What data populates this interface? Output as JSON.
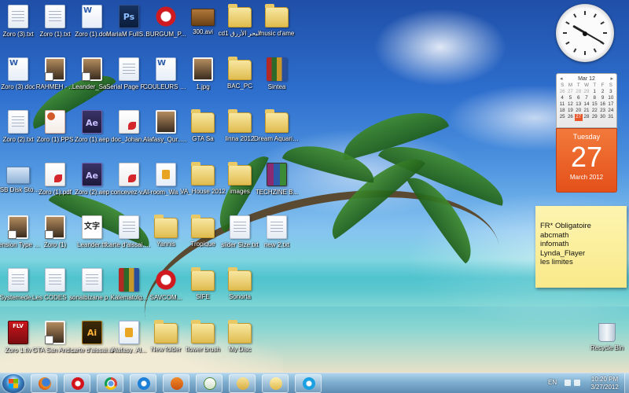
{
  "desktop": {
    "icons": [
      {
        "label": "Zoro (3).txt",
        "type": "doc"
      },
      {
        "label": "Zoro (1).txt",
        "type": "doc"
      },
      {
        "label": "Zoro (1).doc",
        "type": "word"
      },
      {
        "label": "MariaM FullServices...",
        "type": "psd"
      },
      {
        "label": "BURGUM_P...",
        "type": "opera"
      },
      {
        "label": "300.avi",
        "type": "media"
      },
      {
        "label": "cd1 البحر الأزرق",
        "type": "folder"
      },
      {
        "label": "music d'ame",
        "type": "folder"
      },
      {
        "label": "Zoro (3).doc",
        "type": "word"
      },
      {
        "label": "RAHMEH - ...",
        "type": "image"
      },
      {
        "label": "Leander_Sa...",
        "type": "image"
      },
      {
        "label": "Serial Page Plus.txt",
        "type": "doc"
      },
      {
        "label": "COULEURS ET COMM...",
        "type": "word"
      },
      {
        "label": "1.jpg",
        "type": "image"
      },
      {
        "label": "BAC_PC",
        "type": "folder"
      },
      {
        "label": "Sintea",
        "type": "books"
      },
      {
        "label": "Zoro (2).txt",
        "type": "doc"
      },
      {
        "label": "Zoro (1).PPS",
        "type": "ppt"
      },
      {
        "label": "Zoro (1).aep",
        "type": "ae"
      },
      {
        "label": "doc_Johan...",
        "type": "pdf"
      },
      {
        "label": "Alafasy_Qur... Liathan.mp3",
        "type": "image"
      },
      {
        "label": "GTA Sa",
        "type": "folder"
      },
      {
        "label": "linna 2012",
        "type": "folder"
      },
      {
        "label": "Dream Aquariu...",
        "type": "folder"
      },
      {
        "label": "USB Disk Storage Fo...",
        "type": "usb"
      },
      {
        "label": "Zoro (1).pdf",
        "type": "pdf"
      },
      {
        "label": "Zoro (2).aep",
        "type": "ae"
      },
      {
        "label": "concevez-v...",
        "type": "pdf"
      },
      {
        "label": "Al-room_Wa min Ayatih...",
        "type": "audio"
      },
      {
        "label": "VA_House 2012",
        "type": "folder"
      },
      {
        "label": "images",
        "type": "folder"
      },
      {
        "label": "TECHZINE B...",
        "type": "rar"
      },
      {
        "label": "Tension Type Font Licens...",
        "type": "image"
      },
      {
        "label": "Zoro (1)",
        "type": "image"
      },
      {
        "label": "Leander.ttf",
        "type": "font"
      },
      {
        "label": "carte d'aissai.jpg",
        "type": "doc"
      },
      {
        "label": "Yannis",
        "type": "folder"
      },
      {
        "label": "Tropique",
        "type": "folder"
      },
      {
        "label": "slider Size.txt",
        "type": "doc"
      },
      {
        "label": "new 2.txt",
        "type": "doc"
      },
      {
        "label": "Systemede...",
        "type": "doc"
      },
      {
        "label": "Les CODES de GTA Sa.txt",
        "type": "doc"
      },
      {
        "label": "sonaibizane password.txt",
        "type": "doc"
      },
      {
        "label": "Kalematolg...",
        "type": "books"
      },
      {
        "label": "SAVCOM...",
        "type": "opera"
      },
      {
        "label": "SIFE",
        "type": "folder"
      },
      {
        "label": "Sonorta",
        "type": "folder"
      },
      {
        "label": "Zoro 1.flv",
        "type": "flv"
      },
      {
        "label": "GTA San Andreas",
        "type": "image"
      },
      {
        "label": "carte d'aissai.ai",
        "type": "ai"
      },
      {
        "label": "Alafasy_Al...",
        "type": "audio"
      },
      {
        "label": "New folder",
        "type": "folder"
      },
      {
        "label": "flower brush",
        "type": "folder"
      },
      {
        "label": "My Disc",
        "type": "folder"
      }
    ],
    "recycle_bin": {
      "label": "Recycle Bin"
    }
  },
  "clock_gadget": {
    "hour_angle_deg": 300,
    "minute_angle_deg": 120
  },
  "calendar_gadget": {
    "month_header": "Mar 12",
    "weekday_initials": [
      "S",
      "M",
      "T",
      "W",
      "T",
      "F",
      "S"
    ],
    "weeks": [
      [
        "26",
        "27",
        "28",
        "29",
        "1",
        "2",
        "3"
      ],
      [
        "4",
        "5",
        "6",
        "7",
        "8",
        "9",
        "10"
      ],
      [
        "11",
        "12",
        "13",
        "14",
        "15",
        "16",
        "17"
      ],
      [
        "18",
        "19",
        "20",
        "21",
        "22",
        "23",
        "24"
      ],
      [
        "25",
        "26",
        "27",
        "28",
        "29",
        "30",
        "31"
      ]
    ],
    "today_index": [
      4,
      2
    ],
    "weekday": "Tuesday",
    "day": "27",
    "month_year": "March 2012",
    "accent_color": "#e8582c"
  },
  "sticky_note": {
    "lines": [
      "FR* Obligatoire",
      "abcmath",
      "infomath",
      "Lynda_Flayer",
      "les limites"
    ]
  },
  "taskbar": {
    "pinned": [
      {
        "name": "firefox",
        "icon": "firefox-icon"
      },
      {
        "name": "opera",
        "icon": "opera-icon"
      },
      {
        "name": "chrome",
        "icon": "chrome-icon"
      },
      {
        "name": "internet-explorer",
        "icon": "ie-icon"
      },
      {
        "name": "media-player",
        "icon": "media-player-icon"
      },
      {
        "name": "notepad",
        "icon": "notepad-icon"
      },
      {
        "name": "windows-explorer",
        "icon": "explorer-icon"
      },
      {
        "name": "folder",
        "icon": "folder-icon"
      },
      {
        "name": "skype",
        "icon": "skype-icon"
      }
    ],
    "language": "EN",
    "time": "10:20 PM",
    "date": "3/27/2012"
  }
}
